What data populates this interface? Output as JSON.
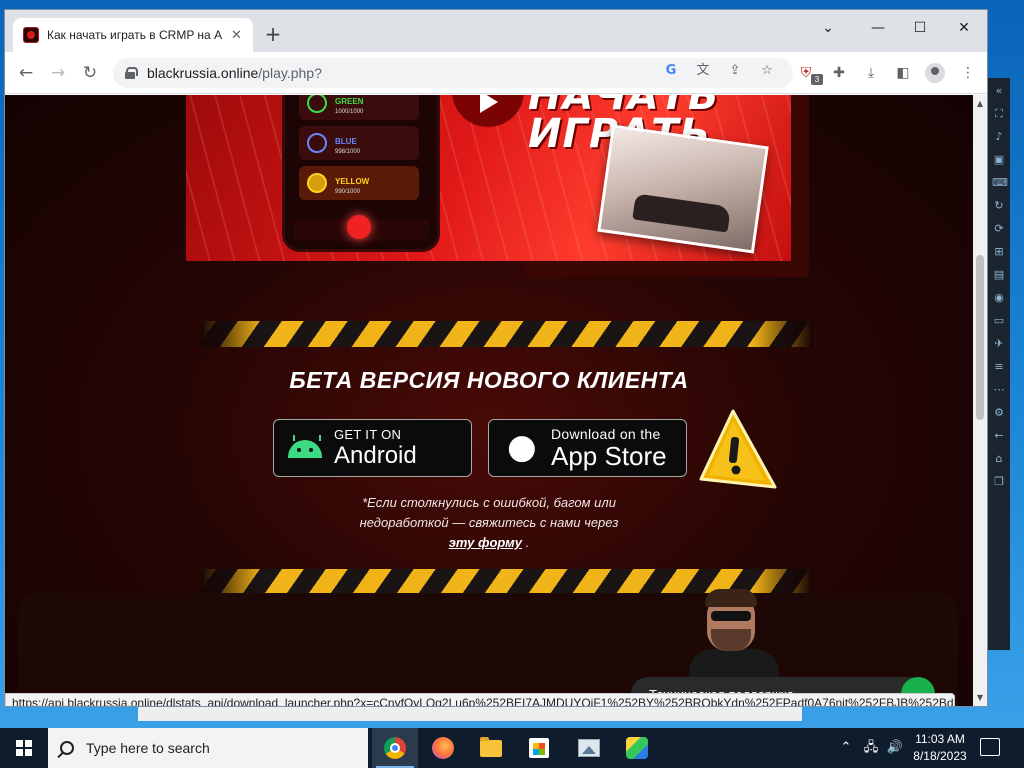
{
  "browser": {
    "tab_title": "Как начать играть в CRMP на А",
    "tab_close": "✕",
    "new_tab": "+",
    "window_controls": {
      "dropdown": "⌄",
      "minimize": "—",
      "maximize": "☐",
      "close": "✕"
    },
    "url_host": "blackrussia.online",
    "url_path": "/play.php?",
    "extension_badge": "3",
    "status_url": "https://api.blackrussia.online/dlstats_api/download_launcher.php?x=cCnyfOyLQg2Lu6p%252BEI7AJMDUYQjF1%252BY%252BRQbkYdn%252FPadf0A76njt%252FBJB%252Bda2av..."
  },
  "banner": {
    "text_line1": "НАЧАТЬ",
    "text_line2": "ИГРАТЬ",
    "phone_cards": [
      {
        "label": "GREEN",
        "sub": "1000/1000",
        "color": "#3ddc4a"
      },
      {
        "label": "BLUE",
        "sub": "998/1000",
        "color": "#6a86ff"
      },
      {
        "label": "YELLOW",
        "sub": "990/1000",
        "color": "#ffd21e"
      }
    ]
  },
  "beta": {
    "title": "БЕТА ВЕРСИЯ НОВОГО КЛИЕНТА",
    "android": {
      "small": "GET IT ON",
      "big": "Android"
    },
    "appstore": {
      "small": "Download on the",
      "big": "App Store"
    },
    "note_line1": "*Если столкнулись с ошибкой, багом или",
    "note_line2": "недоработкой — свяжитесь с нами через",
    "note_link": "эту форму",
    "note_end": "."
  },
  "support": {
    "label": "Техническая поддержка"
  },
  "taskbar": {
    "search_placeholder": "Type here to search",
    "time": "11:03 AM",
    "date": "8/18/2023"
  },
  "colors": {
    "accent_red": "#e01818",
    "hazard_yellow": "#f0b418",
    "android_green": "#3ddc84"
  }
}
